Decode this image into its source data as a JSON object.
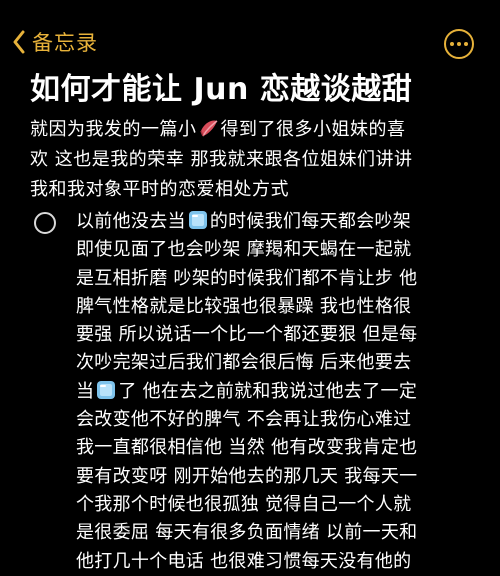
{
  "nav": {
    "back_label": "备忘录",
    "back_icon": "chevron-left-icon",
    "more_icon": "ellipsis-circle-icon",
    "accent_color": "#e7b23a"
  },
  "note": {
    "title": "如何才能让 Jun 恋越谈越甜",
    "intro_lines": [
      "就因为我发的一篇小",
      "得到了很多小姐妹的喜",
      "欢 这也是我的荣幸 那我就来跟各位姐妹们讲讲",
      "我和我对象平时的恋爱相处方式"
    ],
    "intro_icon": "book-icon",
    "checklist_item": {
      "checked": false,
      "lines": [
        "以前他没去当",
        "的时候我们每天都会吵架",
        "即使见面了也会吵架 摩羯和天蝎在一起就",
        "是互相折磨 吵架的时候我们都不肯让步 他",
        "脾气性格就是比较强也很暴躁 我也性格很",
        "要强 所以说话一个比一个都还要狠 但是每",
        "次吵完架过后我们都会很后悔 后来他要去",
        "当",
        "了 他在去之前就和我说过他去了一定",
        "会改变他不好的脾气 不会再让我伤心难过",
        "我一直都很相信他 当然 他有改变我肯定也",
        "要有改变呀 刚开始他去的那几天 我每天一",
        "个我那个时候也很孤独 觉得自己一个人就",
        "是很委屈 每天有很多负面情绪 以前一天和",
        "他打几十个电话 也很难习惯每天没有他的"
      ],
      "inline_icon": "ice-cube-icon"
    }
  }
}
